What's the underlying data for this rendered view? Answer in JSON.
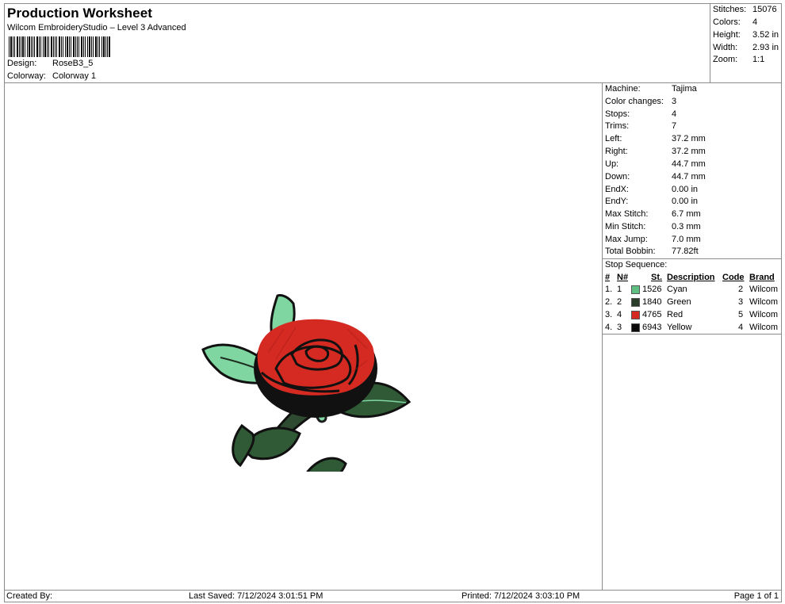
{
  "header": {
    "title": "Production Worksheet",
    "subtitle": "Wilcom EmbroideryStudio – Level 3 Advanced",
    "design_label": "Design:",
    "design_value": "RoseB3_5",
    "colorway_label": "Colorway:",
    "colorway_value": "Colorway 1"
  },
  "summary": {
    "stitches_label": "Stitches:",
    "stitches": "15076",
    "colors_label": "Colors:",
    "colors": "4",
    "height_label": "Height:",
    "height": "3.52 in",
    "width_label": "Width:",
    "width": "2.93 in",
    "zoom_label": "Zoom:",
    "zoom": "1:1"
  },
  "info": {
    "machine_label": "Machine:",
    "machine": "Tajima",
    "color_changes_label": "Color changes:",
    "color_changes": "3",
    "stops_label": "Stops:",
    "stops": "4",
    "trims_label": "Trims:",
    "trims": "7",
    "left_label": "Left:",
    "left": "37.2 mm",
    "right_label": "Right:",
    "right": "37.2 mm",
    "up_label": "Up:",
    "up": "44.7 mm",
    "down_label": "Down:",
    "down": "44.7 mm",
    "endx_label": "EndX:",
    "endx": "0.00 in",
    "endy_label": "EndY:",
    "endy": "0.00 in",
    "max_stitch_label": "Max Stitch:",
    "max_stitch": "6.7 mm",
    "min_stitch_label": "Min Stitch:",
    "min_stitch": "0.3 mm",
    "max_jump_label": "Max Jump:",
    "max_jump": "7.0 mm",
    "total_bobbin_label": "Total Bobbin:",
    "total_bobbin": "77.82ft"
  },
  "stop_sequence": {
    "title": "Stop Sequence:",
    "headers": {
      "num": "#",
      "n": "N#",
      "st": "St.",
      "description": "Description",
      "code": "Code",
      "brand": "Brand"
    },
    "rows": [
      {
        "num": "1.",
        "n": "1",
        "color": "#5fbf82",
        "st": "1526",
        "description": "Cyan",
        "code": "2",
        "brand": "Wilcom"
      },
      {
        "num": "2.",
        "n": "2",
        "color": "#2b3e2c",
        "st": "1840",
        "description": "Green",
        "code": "3",
        "brand": "Wilcom"
      },
      {
        "num": "3.",
        "n": "4",
        "color": "#d42a22",
        "st": "4765",
        "description": "Red",
        "code": "5",
        "brand": "Wilcom"
      },
      {
        "num": "4.",
        "n": "3",
        "color": "#0a0a0a",
        "st": "6943",
        "description": "Yellow",
        "code": "4",
        "brand": "Wilcom"
      }
    ]
  },
  "footer": {
    "created_by": "Created By:",
    "last_saved": "Last Saved: 7/12/2024 3:01:51 PM",
    "printed": "Printed: 7/12/2024 3:03:10 PM",
    "page": "Page 1 of 1"
  }
}
